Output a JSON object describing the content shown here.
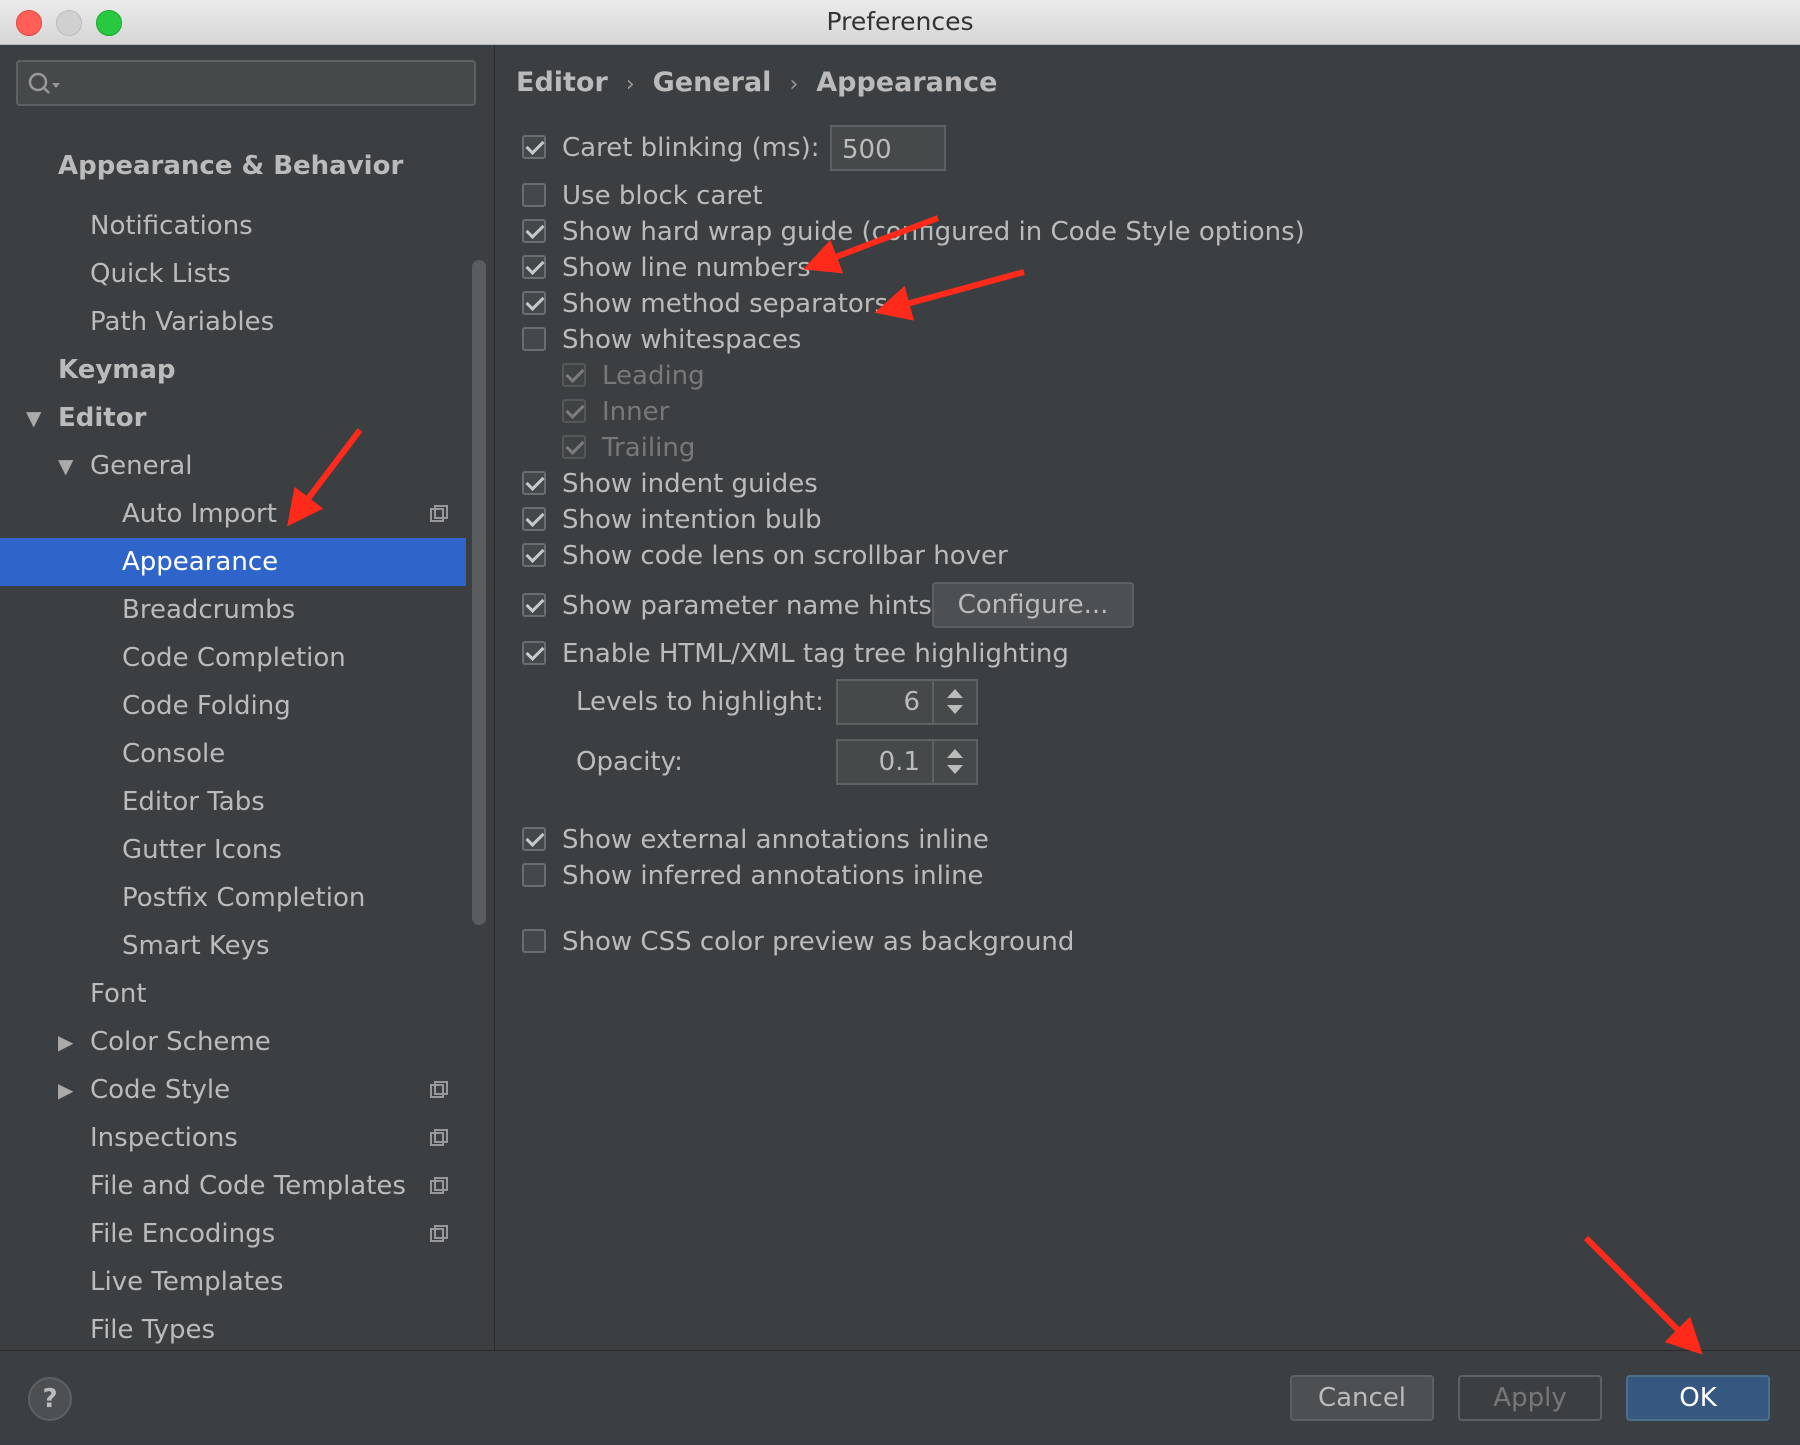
{
  "window": {
    "title": "Preferences"
  },
  "sidebar": {
    "search_placeholder": "",
    "items": [
      {
        "label": "Appearance & Behavior",
        "bold": true
      },
      {
        "label": "Notifications"
      },
      {
        "label": "Quick Lists"
      },
      {
        "label": "Path Variables"
      },
      {
        "label": "Keymap",
        "bold": true
      },
      {
        "label": "Editor",
        "bold": true,
        "expanded": true
      },
      {
        "label": "General",
        "expanded": true
      },
      {
        "label": "Auto Import"
      },
      {
        "label": "Appearance",
        "selected": true
      },
      {
        "label": "Breadcrumbs"
      },
      {
        "label": "Code Completion"
      },
      {
        "label": "Code Folding"
      },
      {
        "label": "Console"
      },
      {
        "label": "Editor Tabs"
      },
      {
        "label": "Gutter Icons"
      },
      {
        "label": "Postfix Completion"
      },
      {
        "label": "Smart Keys"
      },
      {
        "label": "Font"
      },
      {
        "label": "Color Scheme",
        "collapsed": true
      },
      {
        "label": "Code Style",
        "collapsed": true
      },
      {
        "label": "Inspections"
      },
      {
        "label": "File and Code Templates"
      },
      {
        "label": "File Encodings"
      },
      {
        "label": "Live Templates"
      },
      {
        "label": "File Types"
      }
    ]
  },
  "breadcrumb": [
    "Editor",
    "General",
    "Appearance"
  ],
  "options": {
    "caret_blinking": {
      "label": "Caret blinking (ms):",
      "checked": true,
      "value": "500"
    },
    "block_caret": {
      "label": "Use block caret",
      "checked": false
    },
    "hard_wrap": {
      "label": "Show hard wrap guide (configured in Code Style options)",
      "checked": true
    },
    "line_numbers": {
      "label": "Show line numbers",
      "checked": true
    },
    "method_separators": {
      "label": "Show method separators",
      "checked": true
    },
    "whitespaces": {
      "label": "Show whitespaces",
      "checked": false
    },
    "leading": {
      "label": "Leading",
      "checked": true,
      "disabled": true
    },
    "inner": {
      "label": "Inner",
      "checked": true,
      "disabled": true
    },
    "trailing": {
      "label": "Trailing",
      "checked": true,
      "disabled": true
    },
    "indent_guides": {
      "label": "Show indent guides",
      "checked": true
    },
    "intention_bulb": {
      "label": "Show intention bulb",
      "checked": true
    },
    "code_lens": {
      "label": "Show code lens on scrollbar hover",
      "checked": true
    },
    "param_hints": {
      "label": "Show parameter name hints",
      "checked": true,
      "button": "Configure..."
    },
    "tag_tree": {
      "label": "Enable HTML/XML tag tree highlighting",
      "checked": true
    },
    "levels": {
      "label": "Levels to highlight:",
      "value": "6"
    },
    "opacity": {
      "label": "Opacity:",
      "value": "0.1"
    },
    "external_annotations": {
      "label": "Show external annotations inline",
      "checked": true
    },
    "inferred_annotations": {
      "label": "Show inferred annotations inline",
      "checked": false
    },
    "css_color_preview": {
      "label": "Show CSS color preview as background",
      "checked": false
    }
  },
  "footer": {
    "help": "?",
    "cancel": "Cancel",
    "apply": "Apply",
    "ok": "OK"
  },
  "colors": {
    "accent": "#2f65ca",
    "primary_button": "#365880",
    "annotation_arrows": "#ff2a1a"
  }
}
